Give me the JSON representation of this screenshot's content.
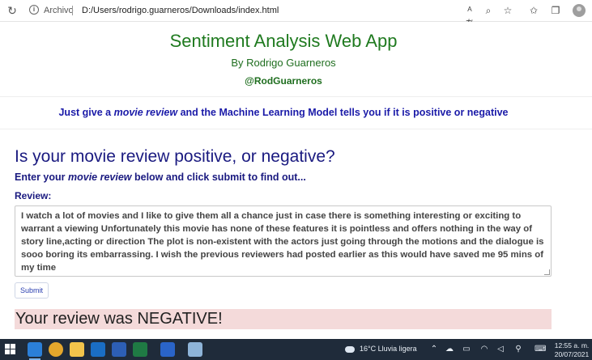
{
  "browser": {
    "protocol_label": "Archivo",
    "url": "D:/Users/rodrigo.guarneros/Downloads/index.html"
  },
  "header": {
    "title": "Sentiment Analysis Web App",
    "author": "By Rodrigo Guarneros",
    "handle": "@RodGuarneros"
  },
  "tagline": {
    "prefix": "Just give a ",
    "emphasis": "movie review",
    "suffix": " and the Machine Learning Model tells you if it is positive or negative"
  },
  "form": {
    "question": "Is your movie review positive, or negative?",
    "instruction_prefix": "Enter your ",
    "instruction_emphasis": "movie review",
    "instruction_suffix": " below and click submit to find out...",
    "review_label": "Review:",
    "review_text": "I watch a lot of movies and I like to give them all a chance just in case there is something interesting or exciting to warrant a viewing Unfortunately this movie has none of these features it is pointless and offers nothing in the way of story line,acting or direction The plot is non-existent with the actors just going through the motions and the dialogue is sooo boring its embarrassing. I wish the previous reviewers had posted earlier as this would have saved me 95 mins of my time",
    "submit_label": "Submit"
  },
  "result": {
    "text": "Your review was NEGATIVE!"
  },
  "taskbar": {
    "weather": "16°C  Lluvia ligera",
    "time": "12:55 a. m.",
    "date": "20/07/2021"
  },
  "colors": {
    "title_green": "#1f7a1f",
    "heading_blue": "#1a1a80",
    "tagline_blue": "#1a1aa8",
    "result_bg": "#f4dada",
    "taskbar_bg": "#1f2b3a"
  }
}
